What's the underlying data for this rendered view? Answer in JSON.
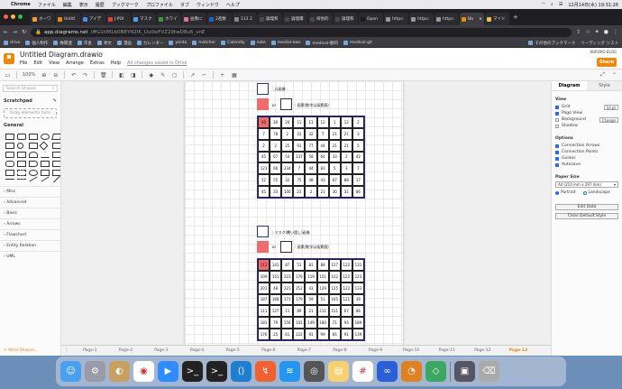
{
  "menubar": {
    "app": "Chrome",
    "items": [
      "ファイル",
      "編集",
      "表示",
      "履歴",
      "ブックマーク",
      "プロファイル",
      "タブ",
      "ウィンドウ",
      "ヘルプ"
    ],
    "clock": "12月14日(水) 19:31:26"
  },
  "tabs": [
    {
      "label": "ホーワ"
    },
    {
      "label": "Untitl"
    },
    {
      "label": "アイデ"
    },
    {
      "label": "J-POI"
    },
    {
      "label": "マスク"
    },
    {
      "label": "ホワイ"
    },
    {
      "label": "画像に"
    },
    {
      "label": "2進数"
    },
    {
      "label": "112 2"
    },
    {
      "label": "論理和"
    },
    {
      "label": "論理積"
    },
    {
      "label": "排他的"
    },
    {
      "label": "論理和"
    },
    {
      "label": "Open"
    },
    {
      "label": "https:"
    },
    {
      "label": "https:"
    },
    {
      "label": "https:"
    },
    {
      "label": "Un"
    },
    {
      "label": "マイド"
    }
  ],
  "address": {
    "host": "app.diagrams.net",
    "path": "/#G1hM1b0B8YN2IK_Uu0wFVZ29twD8u6_vnE"
  },
  "bookmarks": {
    "items": [
      "drive",
      "個人制作",
      "株関連",
      "年金",
      "青文",
      "漫画",
      "カレンダー",
      "yenta",
      "matcher",
      "Calendly",
      "note",
      "medial-aws",
      "medical-静岡",
      "medical-git"
    ],
    "others": "その他のブックマーク",
    "reading": "リーディング リスト"
  },
  "drawio": {
    "doc_title": "Untitled Diagram.drawio",
    "menus": [
      "File",
      "Edit",
      "View",
      "Arrange",
      "Extras",
      "Help"
    ],
    "saved_note": "All changes saved in Drive",
    "user": "KUROKO BLOG",
    "share": "Share",
    "zoom": "100%"
  },
  "sidebar": {
    "search_placeholder": "Search Shapes",
    "scratchpad": "Scratchpad",
    "drop_hint": "Drag elements here",
    "general": "General",
    "categories": [
      "Misc",
      "Advanced",
      "Basic",
      "Arrows",
      "Flowchart",
      "Entity Relation",
      "UML"
    ],
    "more_shapes": "+ More Shapes..."
  },
  "canvas": {
    "legend1": {
      "white_label": ": 元画像",
      "or_text": "or",
      "plain_label": ": 画素(数字は画素値)"
    },
    "legend2": {
      "white_label": ": マスク(覆い隠し)画像",
      "or_text": "or",
      "plain_label": ": 画素(数字は画素値)"
    },
    "matrix1": [
      [
        "40",
        "30",
        "20",
        "11",
        "13",
        "12",
        "1",
        "12",
        "2"
      ],
      [
        "7",
        "78",
        "2",
        "22",
        "32",
        "7",
        "21",
        "21",
        "3"
      ],
      [
        "2",
        "2",
        "25",
        "91",
        "77",
        "44",
        "21",
        "21",
        "5"
      ],
      [
        "45",
        "67",
        "54",
        "137",
        "58",
        "64",
        "33",
        "2",
        "42"
      ],
      [
        "123",
        "66",
        "234",
        "7",
        "44",
        "83",
        "5",
        "3",
        "7"
      ],
      [
        "12",
        "55",
        "32",
        "75",
        "48",
        "43",
        "67",
        "88",
        "17"
      ],
      [
        "45",
        "33",
        "100",
        "23",
        "2",
        "21",
        "30",
        "31",
        "86"
      ]
    ],
    "matrix2": [
      [
        "112",
        "141",
        "87",
        "51",
        "81",
        "88",
        "127",
        "122",
        "131"
      ],
      [
        "109",
        "151",
        "223",
        "176",
        "119",
        "151",
        "122",
        "122",
        "123"
      ],
      [
        "201",
        "48",
        "221",
        "212",
        "43",
        "129",
        "125",
        "122",
        "133"
      ],
      [
        "187",
        "168",
        "171",
        "179",
        "59",
        "51",
        "165",
        "121",
        "39"
      ],
      [
        "111",
        "127",
        "11",
        "89",
        "21",
        "211",
        "151",
        "67",
        "86"
      ],
      [
        "181",
        "79",
        "156",
        "101",
        "149",
        "180",
        "71",
        "93",
        "189"
      ],
      [
        "176",
        "25",
        "61",
        "222",
        "91",
        "99",
        "66",
        "91",
        "139"
      ]
    ]
  },
  "rpanel": {
    "tabs": [
      "Diagram",
      "Style"
    ],
    "view_title": "View",
    "grid": "Grid",
    "grid_size": "10 pt",
    "page_view": "Page View",
    "background": "Background",
    "change": "Change",
    "shadow": "Shadow",
    "options_title": "Options",
    "connection_arrows": "Connection Arrows",
    "connection_points": "Connection Points",
    "guides": "Guides",
    "autosave": "Autosave",
    "paper_title": "Paper Size",
    "paper_value": "A4 (210 mm x 297 mm)",
    "portrait": "Portrait",
    "landscape": "Landscape",
    "edit_data": "Edit Data",
    "clear_style": "Clear Default Style"
  },
  "pages": [
    "Page-1",
    "Page-2",
    "Page-3",
    "Page-4",
    "Page-5",
    "Page-6",
    "Page-7",
    "Page-8",
    "Page-9",
    "Page-10",
    "Page-11",
    "Page-12",
    "Page-13"
  ],
  "colors": {
    "drawio_orange": "#f08705",
    "matrix_border": "#2a2ab0",
    "highlight": "#f06b6b"
  },
  "dock_icons": [
    "finder-icon",
    "settings-icon",
    "preview-icon",
    "chrome-icon",
    "zoom-icon",
    "terminal-icon",
    "terminal-icon",
    "vscode-icon",
    "postman-icon",
    "docker-icon",
    "quicktime-icon",
    "notes-icon",
    "slack-icon",
    "loop-icon",
    "mysql-workbench-icon",
    "kapture-icon",
    "screenshot-icon",
    "trash-icon"
  ]
}
